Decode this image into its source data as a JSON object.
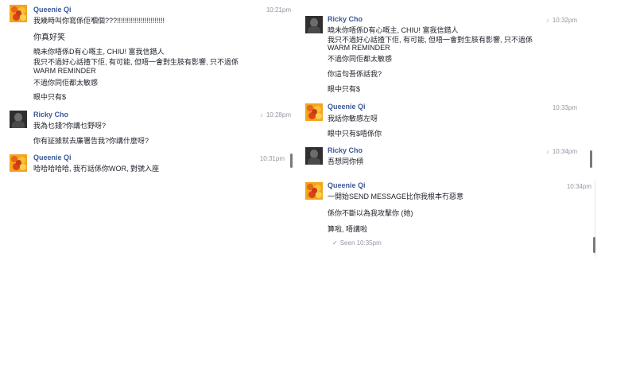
{
  "colors": {
    "name": "#3b5998",
    "time": "#9197a3",
    "queenie_avatar": "#f3a51c",
    "ricky_avatar": "#2f2f2f"
  },
  "left": {
    "msgs": [
      {
        "sender": "Queenie Qi",
        "time": "10:21pm",
        "device": "",
        "lines": [
          "我幾時叫你寫係佢嗰個???!!!!!!!!!!!!!!!!!!!!!!!!",
          "你真好笑",
          "曉未你唔係D有心嘅主, CHIU! 富我信錯人",
          "我只不過好心話揸下佢, 有可能, 但唔一會對生肢有影響, 只不過係",
          "WARM REMINDER",
          "不過你同佢都太敏感",
          "眼中只有$"
        ]
      },
      {
        "sender": "Ricky Cho",
        "time": "10:28pm",
        "device": "♪",
        "lines": [
          "我為乜錢?你講乜野呀?",
          "你有証據就去廉署告我?你講什麼呀?"
        ]
      },
      {
        "sender": "Queenie Qi",
        "time": "10:31pm",
        "device": "",
        "lines": [
          "哈哈哈哈哈, 我冇話係你WOR, 對號入座"
        ]
      }
    ]
  },
  "right1": {
    "msgs": [
      {
        "sender": "Ricky Cho",
        "time": "10:32pm",
        "device": "♪",
        "lines": [
          "曉未你唔係D有心嘅主, CHIU! 富我信錯人",
          "我只不過好心話揸下佢, 有可能, 但唔一會對生肢有影響, 只不過係",
          "WARM REMINDER",
          "不過你同佢都太敏感",
          "你這句吾係話我?",
          "眼中只有$"
        ]
      },
      {
        "sender": "Queenie Qi",
        "time": "10:33pm",
        "device": "",
        "lines": [
          "我話你敏感左呀",
          "眼中只有$唔係你"
        ]
      },
      {
        "sender": "Ricky Cho",
        "time": "10:34pm",
        "device": "♪",
        "lines": [
          "吾想同你傾"
        ]
      }
    ]
  },
  "right2": {
    "msgs": [
      {
        "sender": "Queenie Qi",
        "time": "10:34pm",
        "device": "",
        "lines": [
          "一開始SEND MESSAGE比你我根本冇惡意",
          "係你不斷以為我攻擊你 (她)",
          "算啦, 唔講啦"
        ]
      }
    ],
    "seen": "Seen 10:35pm"
  }
}
